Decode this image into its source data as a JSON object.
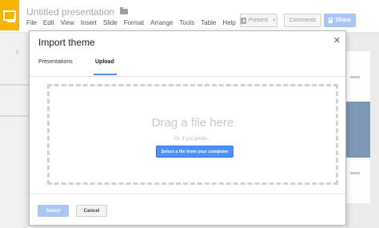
{
  "app": {
    "doc_title": "Untitled presentation",
    "menu": [
      "File",
      "Edit",
      "View",
      "Insert",
      "Slide",
      "Format",
      "Arrange",
      "Tools",
      "Table",
      "Help",
      "/"
    ],
    "present_label": "Present",
    "comments_label": "Comments",
    "share_label": "Share",
    "filmstrip_number": "1"
  },
  "icons": {
    "logo": "slides-logo-icon",
    "star": "star-icon",
    "folder": "folder-icon",
    "play": "play-icon",
    "lock": "lock-icon",
    "close": "close-icon"
  },
  "modal": {
    "title": "Import theme",
    "tabs": [
      {
        "label": "Presentations",
        "active": false
      },
      {
        "label": "Upload",
        "active": true
      }
    ],
    "drop_heading": "Drag a file here",
    "drop_sub": "Or, if you prefer...",
    "select_file_label": "Select a file from your computer",
    "select_label": "Select",
    "cancel_label": "Cancel"
  },
  "colors": {
    "accent_blue": "#4d90fe",
    "disabled_blue": "#a9c6f5",
    "logo_yellow": "#f4b400"
  }
}
